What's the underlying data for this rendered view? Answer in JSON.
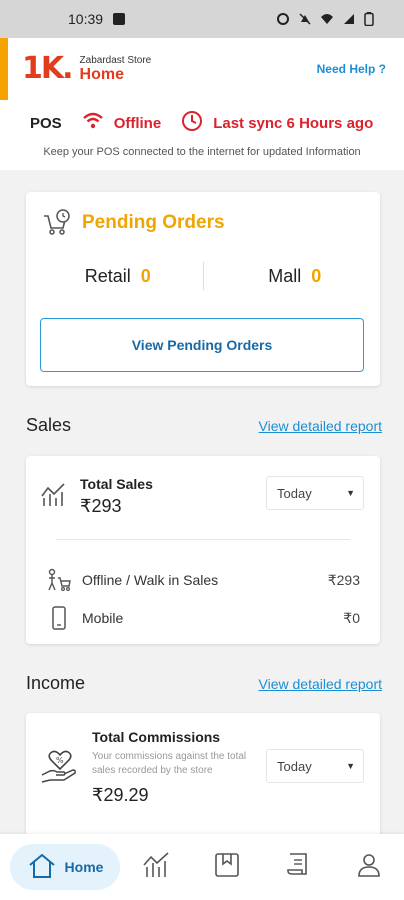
{
  "status_bar": {
    "time": "10:39"
  },
  "header": {
    "logo_text": "1K.",
    "store_name": "Zabardast Store",
    "title": "Home",
    "help_label": "Need Help ?"
  },
  "pos": {
    "label": "POS",
    "status": "Offline",
    "sync": "Last sync 6 Hours ago",
    "info": "Keep your POS connected to the internet for updated Information"
  },
  "pending": {
    "title": "Pending Orders",
    "retail_label": "Retail",
    "retail_count": "0",
    "mall_label": "Mall",
    "mall_count": "0",
    "button": "View Pending Orders"
  },
  "sales": {
    "section_title": "Sales",
    "report_link": "View detailed report",
    "total_label": "Total Sales",
    "total_value": "₹293",
    "period": "Today",
    "rows": [
      {
        "label": "Offline / Walk in Sales",
        "value": "₹293"
      },
      {
        "label": "Mobile",
        "value": "₹0"
      }
    ]
  },
  "income": {
    "section_title": "Income",
    "report_link": "View detailed report",
    "total_label": "Total Commissions",
    "description": "Your commissions against the total sales recorded by the store",
    "total_value": "₹29.29",
    "period": "Today"
  },
  "nav": {
    "home_label": "Home"
  },
  "colors": {
    "brand_orange": "#f6a200",
    "brand_red": "#e23b1e",
    "link_blue": "#1a8fd4",
    "alert_red": "#d9232d"
  }
}
